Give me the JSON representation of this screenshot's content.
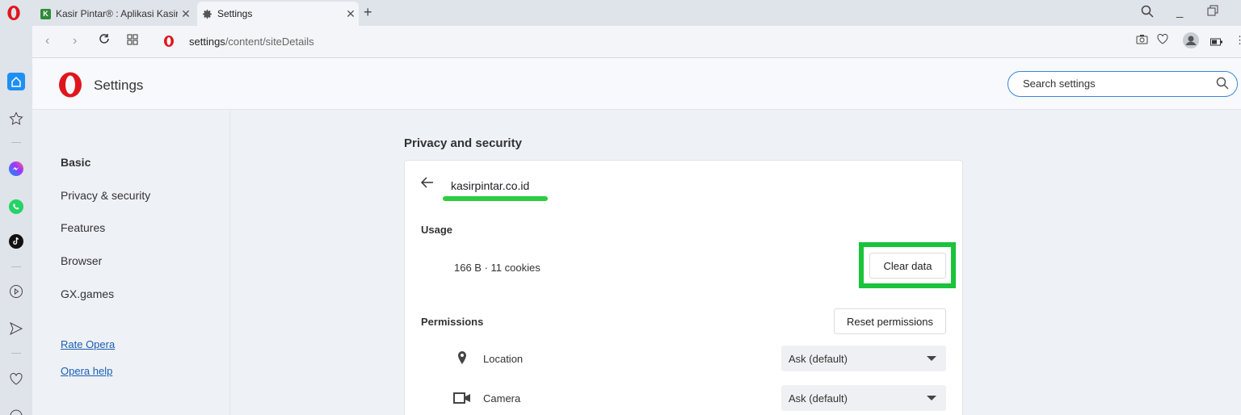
{
  "browser": {
    "tabs": [
      {
        "title": "Kasir Pintar® : Aplikasi Kasir",
        "active": false
      },
      {
        "title": "Settings",
        "active": true
      }
    ],
    "url_host": "settings",
    "url_path": "/content/siteDetails"
  },
  "header": {
    "title": "Settings",
    "search_placeholder": "Search settings"
  },
  "nav": {
    "items": [
      {
        "label": "Basic"
      },
      {
        "label": "Privacy & security"
      },
      {
        "label": "Features"
      },
      {
        "label": "Browser"
      },
      {
        "label": "GX.games"
      }
    ],
    "links": [
      {
        "label": "Rate Opera"
      },
      {
        "label": "Opera help"
      }
    ]
  },
  "content": {
    "section_title": "Privacy and security",
    "site": "kasirpintar.co.id",
    "usage_label": "Usage",
    "usage_value": "166 B · 11 cookies",
    "clear_button": "Clear data",
    "permissions_label": "Permissions",
    "reset_button": "Reset permissions",
    "permissions": [
      {
        "name": "Location",
        "value": "Ask (default)",
        "icon": "location-pin-icon"
      },
      {
        "name": "Camera",
        "value": "Ask (default)",
        "icon": "camera-icon"
      }
    ]
  },
  "colors": {
    "highlight": "#19c33a",
    "opera_red": "#e0161e",
    "link": "#1a5fb4"
  }
}
